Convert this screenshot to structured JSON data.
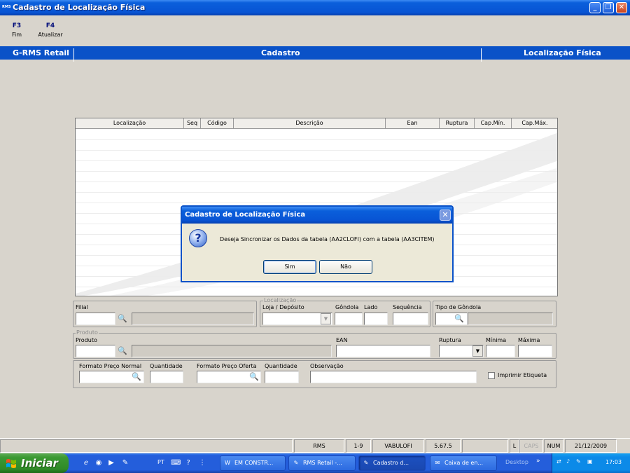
{
  "window": {
    "title": "Cadastro de Localização Física",
    "app_icon": "RMS"
  },
  "fkeys": [
    {
      "key": "F3",
      "label": "Fim"
    },
    {
      "key": "F4",
      "label": "Atualizar"
    }
  ],
  "header": {
    "left": "G-RMS Retail",
    "center": "Cadastro",
    "right": "Localização Física"
  },
  "grid": {
    "columns": [
      "Localização",
      "Seq",
      "Código",
      "Descrição",
      "Ean",
      "Ruptura",
      "Cap.Mín.",
      "Cap.Máx."
    ]
  },
  "form": {
    "filial_label": "Filial",
    "localizacao_group": "Localização",
    "loja_label": "Loja / Depósito",
    "gondola_label": "Gôndola",
    "lado_label": "Lado",
    "sequencia_label": "Sequência",
    "tipo_gondola_label": "Tipo de Gôndola",
    "produto_group": "Produto",
    "produto_label": "Produto",
    "ean_label": "EAN",
    "ruptura_label": "Ruptura",
    "minima_label": "Mínima",
    "maxima_label": "Máxima",
    "formato_normal_label": "Formato Preço Normal",
    "quantidade_label": "Quantidade",
    "formato_oferta_label": "Formato Preço Oferta",
    "quantidade2_label": "Quantidade",
    "observacao_label": "Observação",
    "imprimir_label": "Imprimir Etiqueta"
  },
  "dialog": {
    "title": "Cadastro de Localização Física",
    "message": "Deseja Sincronizar os Dados da tabela (AA2CLOFI) com a tabela (AA3CITEM)",
    "yes": "Sim",
    "no": "Não"
  },
  "statusbar": {
    "app": "RMS",
    "range": "1-9",
    "program": "VABULOFI",
    "version": "5.67.5",
    "l": "L",
    "caps": "CAPS",
    "num": "NUM",
    "date": "21/12/2009"
  },
  "taskbar": {
    "start": "Iniciar",
    "lang": "PT",
    "buttons": [
      "EM CONSTR...",
      "RMS Retail -...",
      "Cadastro d...",
      "Caixa de en..."
    ],
    "desktop": "Desktop",
    "time": "17:03"
  }
}
